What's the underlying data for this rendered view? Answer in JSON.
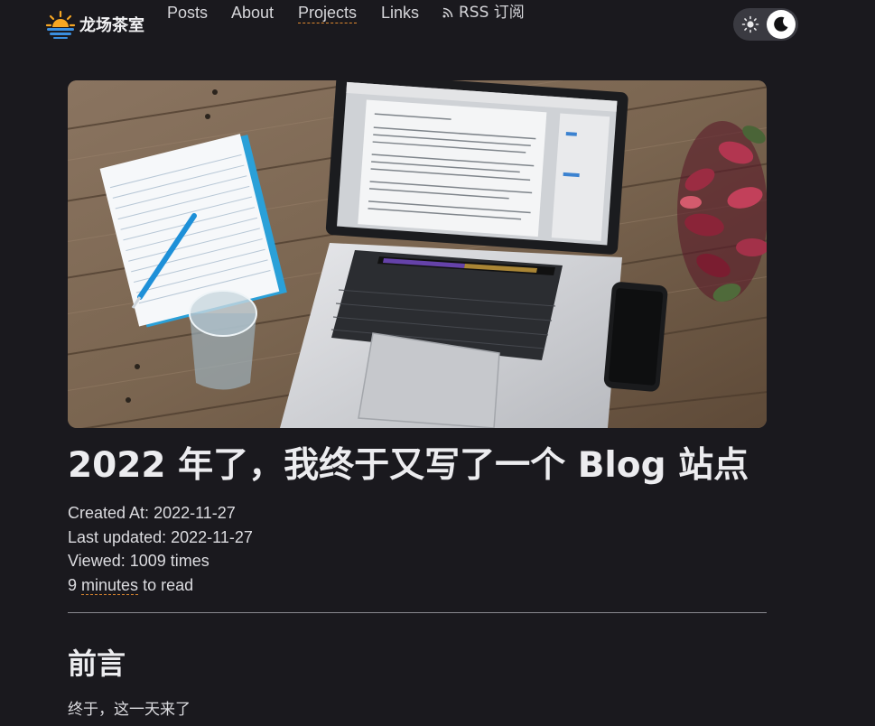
{
  "header": {
    "brand": "龙场茶室",
    "nav": {
      "posts": "Posts",
      "about": "About",
      "projects": "Projects",
      "links": "Links",
      "rss": "RSS 订阅"
    }
  },
  "article": {
    "title": "2022 年了，我终于又写了一个 Blog 站点",
    "created_label": "Created At:",
    "created_value": "2022-11-27",
    "updated_label": "Last updated:",
    "updated_value": "2022-11-27",
    "viewed_label": "Viewed:",
    "viewed_value": "1009 times",
    "read_minutes": "9",
    "read_unit": "minutes",
    "read_suffix": "to read",
    "section_heading": "前言",
    "first_paragraph": "终于，这一天来了"
  },
  "theme": {
    "mode": "dark",
    "sun_icon": "sun-icon",
    "moon_icon": "moon-icon"
  },
  "colors": {
    "background": "#1a191e",
    "accent_underline": "#e0892f",
    "logo_blue": "#3b8fe0",
    "logo_sun": "#f5a623"
  }
}
